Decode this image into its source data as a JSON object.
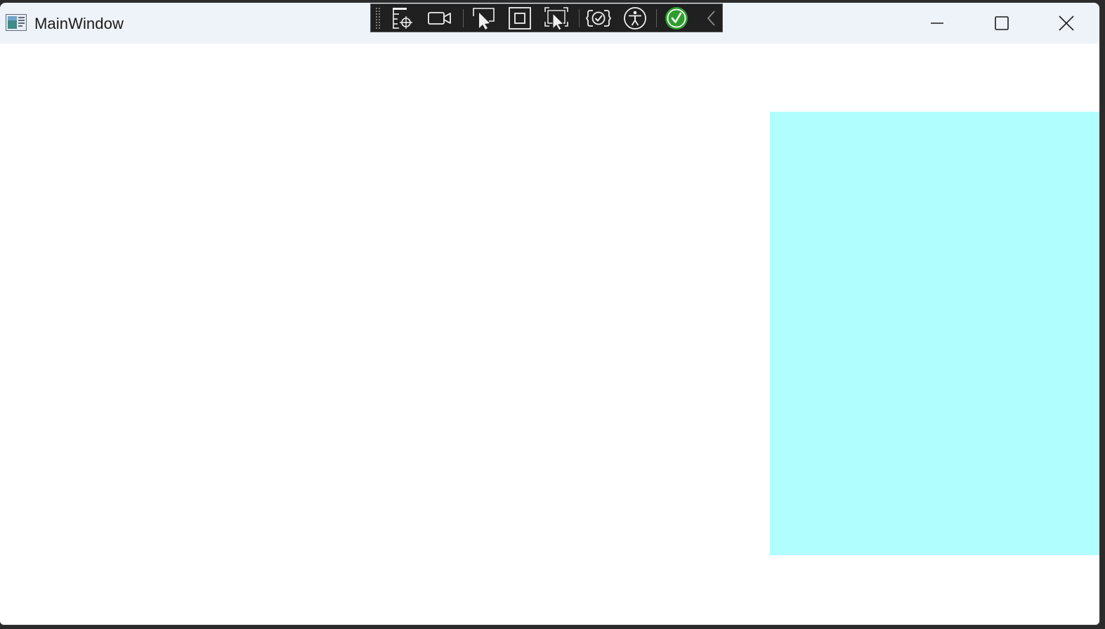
{
  "window": {
    "title": "MainWindow",
    "titlebar_color": "#eef3f9",
    "background_color": "#ffffff"
  },
  "caption_buttons": {
    "minimize_icon": "minimize-icon",
    "maximize_icon": "maximize-icon",
    "close_icon": "close-icon"
  },
  "debug_toolbar": {
    "background_color": "#202020",
    "buttons": [
      {
        "icon": "live-visual-tree-icon"
      },
      {
        "icon": "video-camera-icon"
      },
      {
        "icon": "select-element-icon"
      },
      {
        "icon": "display-layout-adorners-icon"
      },
      {
        "icon": "track-focus-icon"
      },
      {
        "icon": "hot-reload-icon"
      },
      {
        "icon": "accessibility-icon"
      },
      {
        "icon": "binding-check-icon"
      },
      {
        "icon": "collapse-chevron-icon"
      }
    ],
    "status_color": "#2e9d2e"
  },
  "content": {
    "panel_color": "#b0fefe"
  }
}
